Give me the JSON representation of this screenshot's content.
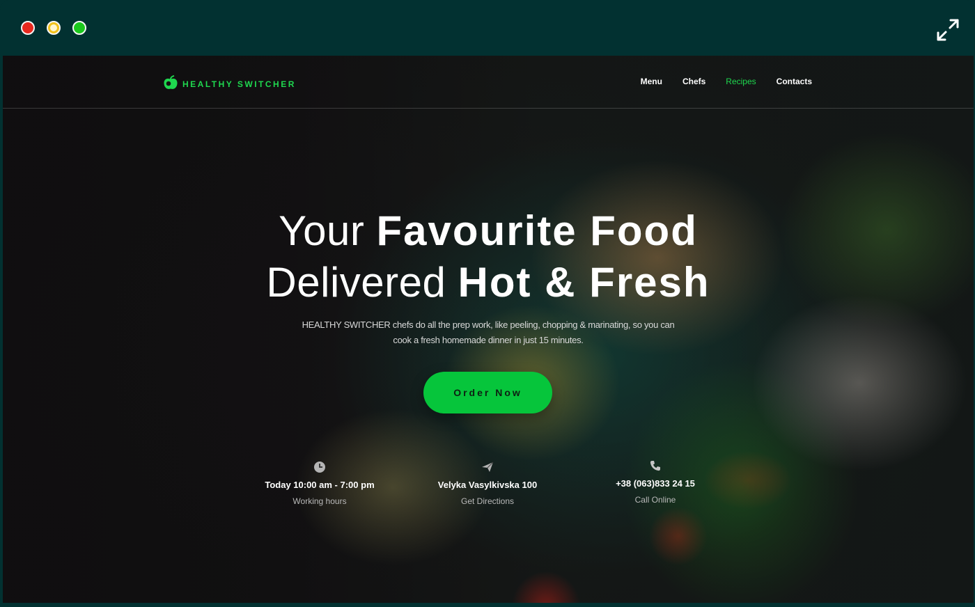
{
  "brand": {
    "name": "HEALTHY SWITCHER",
    "accent_color": "#1fd84f",
    "logo_icon": "apple-icon"
  },
  "nav": {
    "items": [
      {
        "label": "Menu",
        "active": false
      },
      {
        "label": "Chefs",
        "active": false
      },
      {
        "label": "Recipes",
        "active": true
      },
      {
        "label": "Contacts",
        "active": false
      }
    ]
  },
  "hero": {
    "line1_light": "Your",
    "line1_bold": "Favourite Food",
    "line2_light": "Delivered",
    "line2_bold": "Hot & Fresh",
    "subtitle": "HEALTHY SWITCHER chefs do all the prep work, like peeling, chopping & marinating, so you can cook a fresh homemade dinner in just 15 minutes.",
    "cta_label": "Order Now",
    "cta_color": "#06c53b"
  },
  "info": [
    {
      "icon": "clock-icon",
      "value": "Today 10:00 am - 7:00 pm",
      "label": "Working hours"
    },
    {
      "icon": "paper-plane-icon",
      "value": "Velyka Vasylkivska 100",
      "label": "Get Directions"
    },
    {
      "icon": "phone-icon",
      "value": "+38 (063)833 24 15",
      "label": "Call Online"
    }
  ],
  "window": {
    "controls": [
      "close",
      "minimize",
      "maximize"
    ],
    "expand_icon": "expand-icon"
  }
}
